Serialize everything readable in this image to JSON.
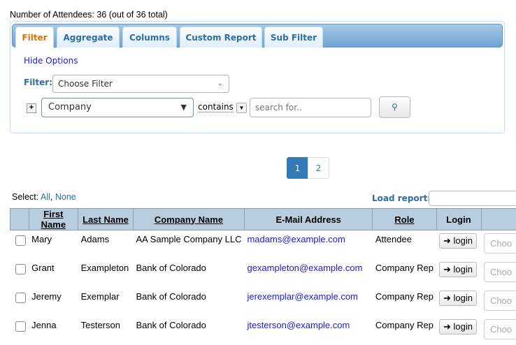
{
  "summary": "Number of Attendees: 36 (out of 36 total)",
  "tabs": [
    "Filter",
    "Aggregate",
    "Columns",
    "Custom Report",
    "Sub Filter"
  ],
  "hide_options": "Hide Options",
  "filter_label": "Filter:",
  "filter_select": "Choose Filter",
  "field_select": "Company",
  "operator": "contains",
  "search_placeholder": "search for..",
  "pages": [
    "1",
    "2"
  ],
  "select_label": "Select:",
  "select_all": "All",
  "select_none": "None",
  "load_report": "Load report:",
  "columns": [
    "First Name",
    "Last Name",
    "Company Name",
    "E-Mail Address",
    "Role",
    "Login"
  ],
  "rows": [
    {
      "first": "Mary",
      "last": "Adams",
      "company": "AA Sample Company LLC",
      "email": "madams@example.com",
      "role": "Attendee"
    },
    {
      "first": "Grant",
      "last": "Exampleton",
      "company": "Bank of Colorado",
      "email": "gexampleton@example.com",
      "role": "Company Rep"
    },
    {
      "first": "Jeremy",
      "last": "Exemplar",
      "company": "Bank of Colorado",
      "email": "jerexemplar@example.com",
      "role": "Company Rep"
    },
    {
      "first": "Jenna",
      "last": "Testerson",
      "company": "Bank of Colorado",
      "email": "jtesterson@example.com",
      "role": "Company Rep"
    }
  ],
  "login_label": "login",
  "row_select_placeholder": "Choo"
}
